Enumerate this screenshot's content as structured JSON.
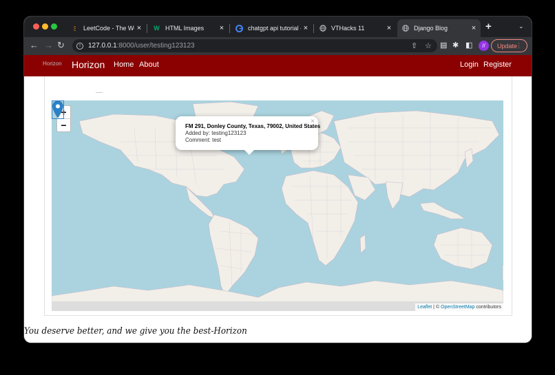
{
  "browser": {
    "tabs": [
      {
        "title": "LeetCode - The World's",
        "favicon": "leetcode-icon",
        "active": false
      },
      {
        "title": "HTML Images",
        "favicon": "w3schools-icon",
        "active": false
      },
      {
        "title": "chatgpt api tutorial - Goo",
        "favicon": "google-icon",
        "active": false
      },
      {
        "title": "VTHacks 11",
        "favicon": "globe-icon",
        "active": false
      },
      {
        "title": "Django Blog",
        "favicon": "globe-icon",
        "active": true
      }
    ],
    "url_host": "127.0.0.1",
    "url_path": ":8000/user/testing123123",
    "update_label": "Update",
    "extension_label": "//"
  },
  "site": {
    "logo_alt": "Horizon",
    "brand": "Horizon",
    "nav_left": [
      "Home",
      "About"
    ],
    "nav_right": [
      "Login",
      "Register"
    ]
  },
  "map": {
    "zoom_in": "+",
    "zoom_out": "−",
    "popup": {
      "address": "FM 291, Donley County, Texas, 79002, United States",
      "added_by": "Added by: testing123123",
      "comment": "Comment: test",
      "close": "×"
    },
    "attribution": {
      "leaflet": "Leaflet",
      "sep": " | © ",
      "osm": "OpenStreetMap",
      "suffix": " contributors"
    },
    "colors": {
      "water": "#aad3df",
      "land": "#f2efe9",
      "marker": "#2a81cb"
    }
  },
  "footer": {
    "tagline": "You deserve better, and we give you the best-Horizon"
  }
}
